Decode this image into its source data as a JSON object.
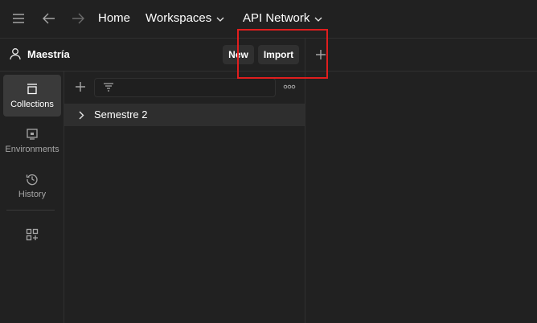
{
  "topbar": {
    "menu_icon": "hamburger-icon",
    "back_icon": "arrow-left-icon",
    "forward_icon": "arrow-right-icon",
    "home_label": "Home",
    "workspaces_label": "Workspaces",
    "api_network_label": "API Network"
  },
  "workspace": {
    "name": "Maestría",
    "new_label": "New",
    "import_label": "Import"
  },
  "rail": {
    "items": [
      {
        "label": "Collections",
        "icon": "collections-icon",
        "active": true
      },
      {
        "label": "Environments",
        "icon": "environments-icon",
        "active": false
      },
      {
        "label": "History",
        "icon": "history-icon",
        "active": false
      }
    ],
    "apps_icon": "add-apps-icon"
  },
  "sidebar": {
    "search_value": "",
    "tree": [
      {
        "label": "Semestre 2",
        "expanded": false
      }
    ]
  },
  "colors": {
    "background": "#212121",
    "active_rail": "#3a3a3a",
    "button_bg": "#303030",
    "highlight": "#e01e1e"
  }
}
